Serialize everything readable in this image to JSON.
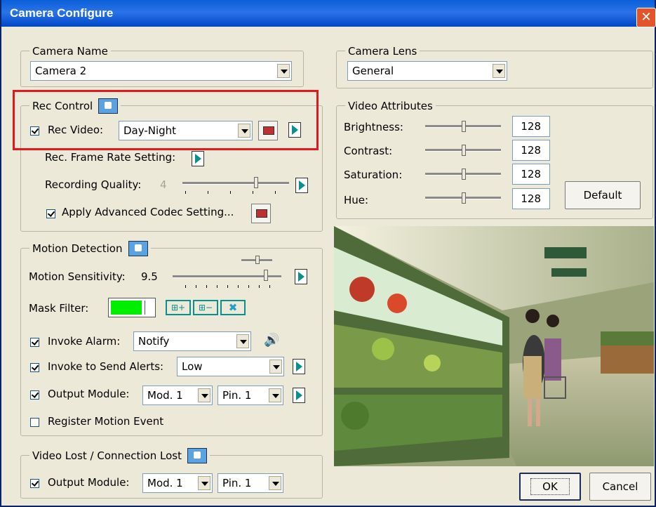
{
  "window": {
    "title": "Camera Configure",
    "close_label": "✕"
  },
  "camera_name": {
    "group_label": "Camera Name",
    "value": "Camera 2"
  },
  "rec_control": {
    "group_label": "Rec Control",
    "rec_video_label": "Rec Video:",
    "rec_video_value": "Day-Night",
    "frame_rate_label": "Rec. Frame Rate Setting:",
    "quality_label": "Recording Quality:",
    "quality_value": "4",
    "quality_level": 0.78,
    "apply_codec_label": "Apply Advanced Codec Setting..."
  },
  "motion_detection": {
    "group_label": "Motion Detection",
    "sensitivity_label": "Motion Sensitivity:",
    "sensitivity_value": "9.5",
    "mask_filter_label": "Mask Filter:",
    "mask_color": "#00ee00",
    "invoke_alarm_label": "Invoke Alarm:",
    "invoke_alarm_value": "Notify",
    "invoke_alerts_label": "Invoke to Send Alerts:",
    "invoke_alerts_value": "Low",
    "output_module_label": "Output Module:",
    "output_module_value": "Mod. 1",
    "output_pin_value": "Pin. 1",
    "register_label": "Register Motion Event"
  },
  "video_lost": {
    "group_label": "Video Lost / Connection Lost",
    "output_module_label": "Output Module:",
    "output_module_value": "Mod. 1",
    "output_pin_value": "Pin. 1"
  },
  "camera_lens": {
    "group_label": "Camera Lens",
    "value": "General"
  },
  "video_attributes": {
    "group_label": "Video Attributes",
    "brightness_label": "Brightness:",
    "brightness_value": "128",
    "contrast_label": "Contrast:",
    "contrast_value": "128",
    "saturation_label": "Saturation:",
    "saturation_value": "128",
    "hue_label": "Hue:",
    "hue_value": "128",
    "default_label": "Default"
  },
  "buttons": {
    "ok_label": "OK",
    "cancel_label": "Cancel"
  },
  "colors": {
    "highlight": "#e0191c",
    "titlebar": "#0a5fd8"
  }
}
